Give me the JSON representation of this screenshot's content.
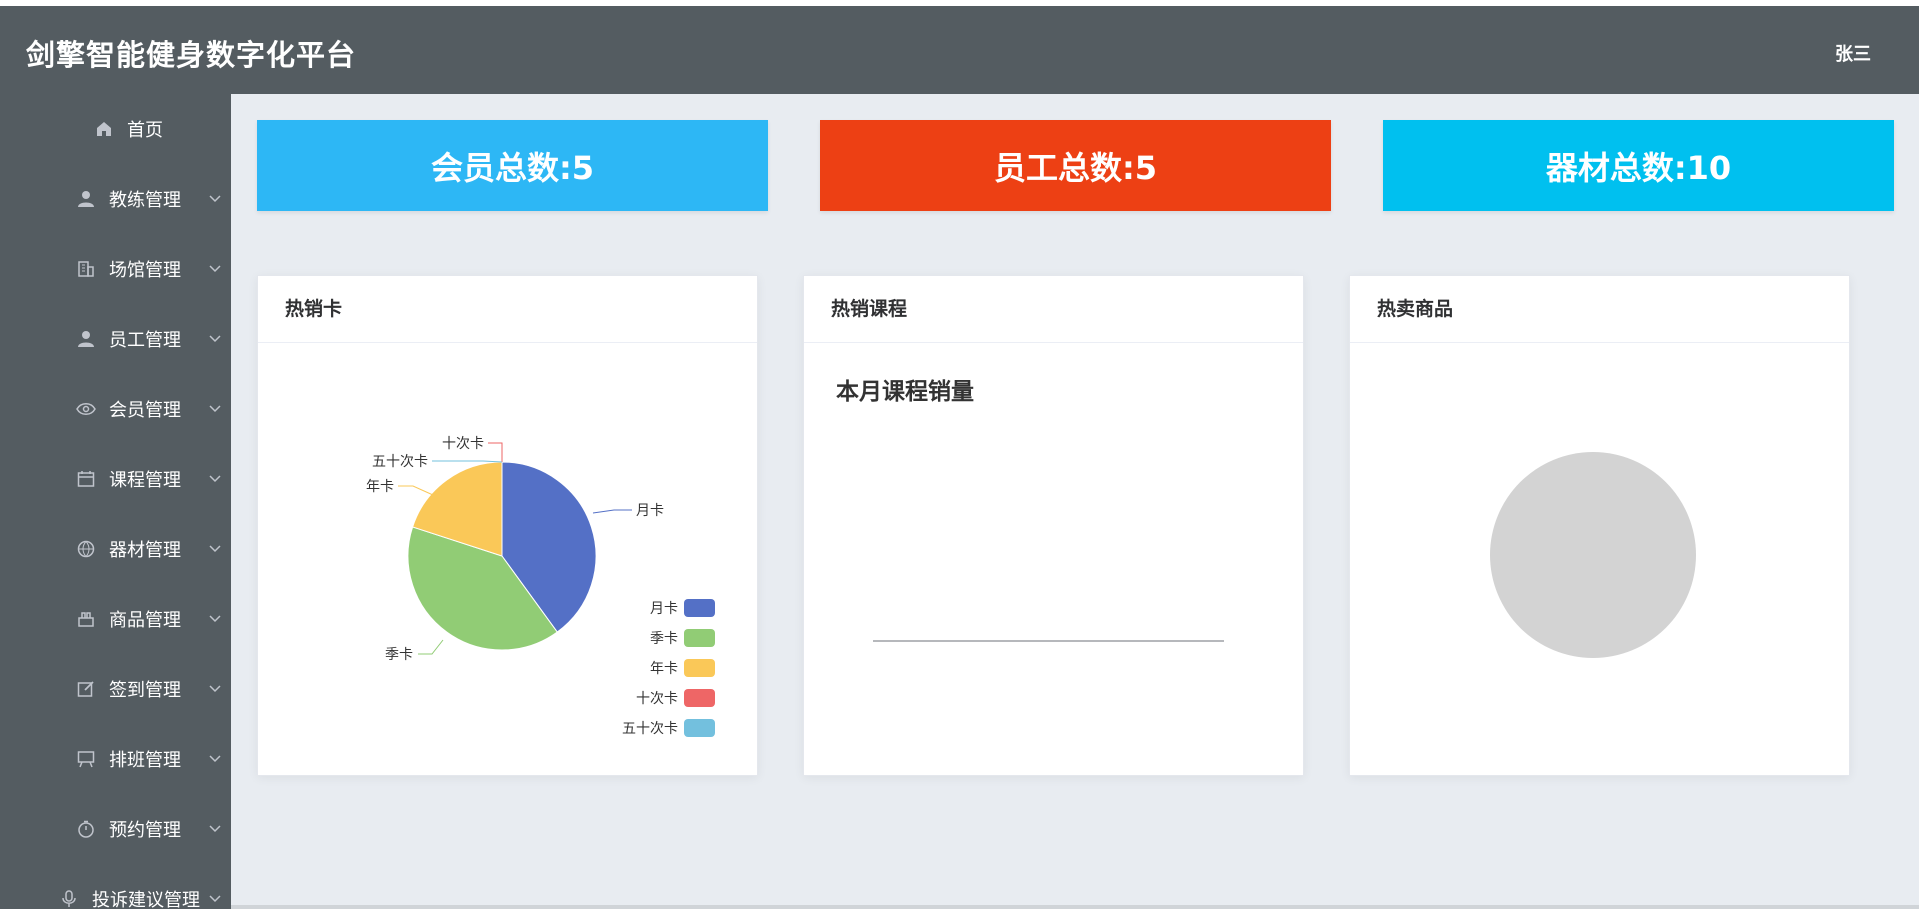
{
  "app": {
    "title": "剑擎智能健身数字化平台",
    "user": "张三"
  },
  "sidebar": {
    "items": [
      {
        "label": "首页",
        "icon": "home-icon"
      },
      {
        "label": "教练管理",
        "icon": "user-icon"
      },
      {
        "label": "场馆管理",
        "icon": "building-icon"
      },
      {
        "label": "员工管理",
        "icon": "user-icon"
      },
      {
        "label": "会员管理",
        "icon": "eye-icon"
      },
      {
        "label": "课程管理",
        "icon": "calendar-icon"
      },
      {
        "label": "器材管理",
        "icon": "basketball-icon"
      },
      {
        "label": "商品管理",
        "icon": "goods-icon"
      },
      {
        "label": "签到管理",
        "icon": "edit-icon"
      },
      {
        "label": "排班管理",
        "icon": "schedule-board-icon"
      },
      {
        "label": "预约管理",
        "icon": "stopwatch-icon"
      },
      {
        "label": "投诉建议管理",
        "icon": "microphone-icon"
      }
    ]
  },
  "stats": {
    "members": "会员总数:5",
    "staff": "员工总数:5",
    "equipment": "器材总数:10",
    "colors": {
      "members": "#2db7f5",
      "staff": "#ed4014",
      "equipment": "#00c0ef"
    }
  },
  "panels": {
    "hot_cards": {
      "title": "热销卡"
    },
    "hot_courses": {
      "title": "热销课程",
      "chart_title": "本月课程销量"
    },
    "hot_goods": {
      "title": "热卖商品"
    }
  },
  "chart_data": [
    {
      "type": "pie",
      "categories": [
        "月卡",
        "季卡",
        "年卡",
        "十次卡",
        "五十次卡"
      ],
      "values": [
        40,
        40,
        20,
        0,
        0
      ],
      "colors": [
        "#5470c6",
        "#91cc75",
        "#fac858",
        "#ee6666",
        "#73c0de"
      ],
      "legend": [
        "月卡",
        "季卡",
        "年卡",
        "十次卡",
        "五十次卡"
      ],
      "legend_position": "bottom-right"
    },
    {
      "type": "bar",
      "title": "本月课程销量",
      "categories": [],
      "values": []
    },
    {
      "type": "pie",
      "categories": [],
      "values": [],
      "empty": true
    }
  ]
}
